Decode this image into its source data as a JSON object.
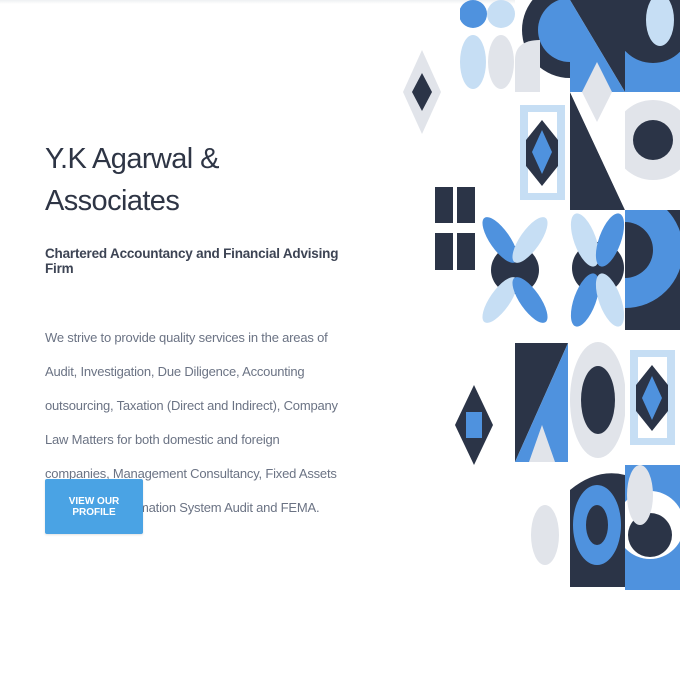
{
  "hero": {
    "title": "Y.K Agarwal & Associates",
    "subtitle": "Chartered Accountancy and Financial Advising Firm",
    "description": "We strive to provide quality services in the areas of Audit, Investigation, Due Diligence, Accounting outsourcing, Taxation (Direct and Indirect), Company Law Matters for both domestic and foreign companies, Management Consultancy, Fixed Assets Verification, Information System Audit and FEMA.",
    "button_label": "VIEW OUR PROFILE"
  },
  "colors": {
    "navy": "#2b3447",
    "blue": "#4f92de",
    "light_blue": "#c6def4",
    "pale_gray": "#e1e4ea",
    "button": "#4aa3e4"
  }
}
